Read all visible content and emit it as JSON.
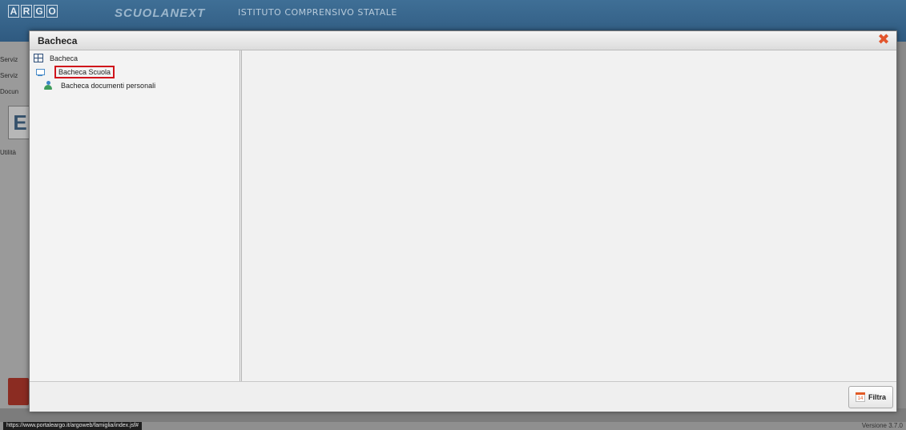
{
  "background": {
    "logo_letters": [
      "A",
      "R",
      "G",
      "O"
    ],
    "brand": "SCUOLANEXT",
    "school_name": "ISTITUTO COMPRENSIVO STATALE",
    "sidebar_labels": [
      "Serviz",
      "Serviz",
      "Docun",
      "Utilità"
    ],
    "tile_letter": "E"
  },
  "modal": {
    "title": "Bacheca",
    "close_icon": "close-icon",
    "tree": [
      {
        "label": "Bacheca",
        "icon": "grid-icon"
      },
      {
        "label": "Bacheca Scuola",
        "icon": "board-icon",
        "selected": true
      },
      {
        "label": "Bacheca documenti personali",
        "icon": "person-document-icon"
      }
    ],
    "footer": {
      "filter_label": "Filtra",
      "calendar_day": "14"
    }
  },
  "status": {
    "url": "https://www.portaleargo.it/argoweb/famiglia/index.jsf#",
    "version": "Versione 3.7.0"
  },
  "colors": {
    "accent_red": "#d0131b",
    "close_orange": "#e2552c",
    "header_blue": "#2f5a80"
  }
}
